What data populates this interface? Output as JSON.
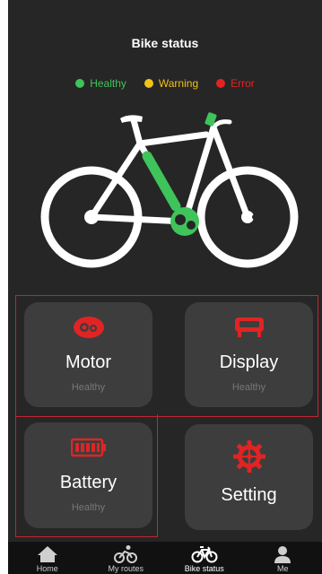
{
  "header": {
    "title": "Bike status"
  },
  "legend": [
    {
      "label": "Healthy",
      "color": "#3ec45a"
    },
    {
      "label": "Warning",
      "color": "#f2c21a"
    },
    {
      "label": "Error",
      "color": "#e02424"
    }
  ],
  "cards": {
    "motor": {
      "label": "Motor",
      "status": "Healthy",
      "icon": "motor-icon"
    },
    "display": {
      "label": "Display",
      "status": "Healthy",
      "icon": "display-icon"
    },
    "battery": {
      "label": "Battery",
      "status": "Healthy",
      "icon": "battery-icon"
    },
    "setting": {
      "label": "Setting",
      "icon": "gear-icon"
    }
  },
  "tabs": [
    {
      "label": "Home",
      "icon": "home-icon"
    },
    {
      "label": "My routes",
      "icon": "cyclist-icon"
    },
    {
      "label": "Bike status",
      "icon": "bicycle-icon",
      "active": true
    },
    {
      "label": "Me",
      "icon": "person-icon"
    }
  ],
  "colors": {
    "accent": "#e02424",
    "background": "#262626",
    "card": "#3d3d3d",
    "healthy": "#3ec45a"
  }
}
